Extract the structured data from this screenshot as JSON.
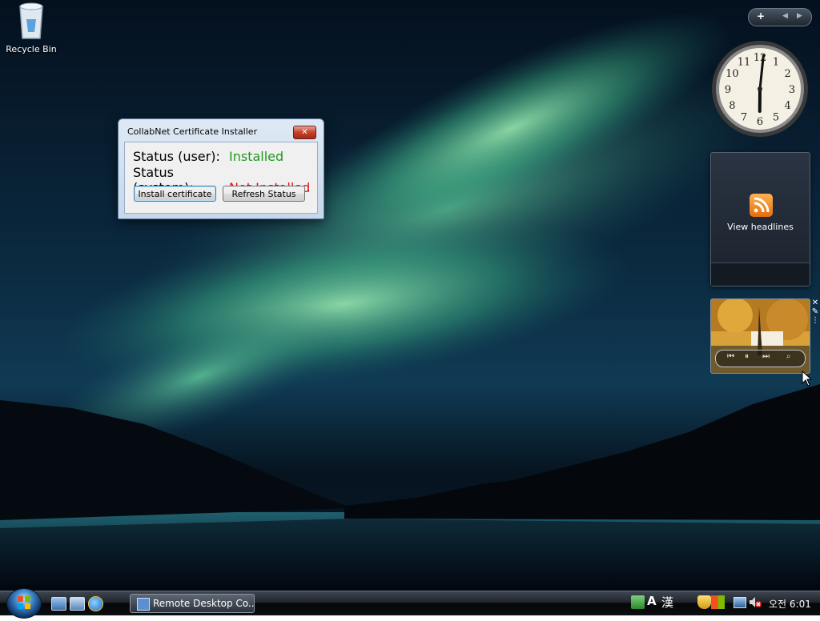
{
  "desktop": {
    "icons": [
      {
        "label": "Recycle Bin",
        "icon": "recycle-bin-icon"
      }
    ]
  },
  "dialog": {
    "title": "CollabNet Certificate Installer",
    "close_glyph": "✕",
    "status_user_label": "Status (user):",
    "status_user_value": "Installed",
    "status_system_label": "Status (system):",
    "status_system_value": "Not Installed",
    "install_button": "Install certificate",
    "refresh_button": "Refresh Status",
    "colors": {
      "installed": "#1f9a1f",
      "not_installed": "#e01010"
    }
  },
  "sidebar": {
    "add_glyph": "+",
    "prev_glyph": "◀",
    "next_glyph": "▶",
    "clock": {
      "hour": 6,
      "minute": 1,
      "numerals": [
        "12",
        "1",
        "2",
        "3",
        "4",
        "5",
        "6",
        "7",
        "8",
        "9",
        "10",
        "11"
      ]
    },
    "feed": {
      "label": "View headlines",
      "icon": "rss-icon"
    },
    "slideshow": {
      "controls": [
        "previous-icon",
        "pause-icon",
        "next-icon",
        "view-icon"
      ]
    }
  },
  "taskbar": {
    "quick_launch": [
      "show-desktop-icon",
      "switch-windows-icon",
      "internet-explorer-icon"
    ],
    "task_buttons": [
      {
        "label": "Remote Desktop Co...",
        "icon": "remote-desktop-icon"
      }
    ],
    "tray": {
      "ime_mode": "A",
      "hanja": "漢",
      "icons": [
        "language-bar-icon",
        "security-shield-icon",
        "windows-update-icon",
        "network-icon",
        "volume-muted-icon"
      ],
      "time": "오전 6:01"
    }
  }
}
